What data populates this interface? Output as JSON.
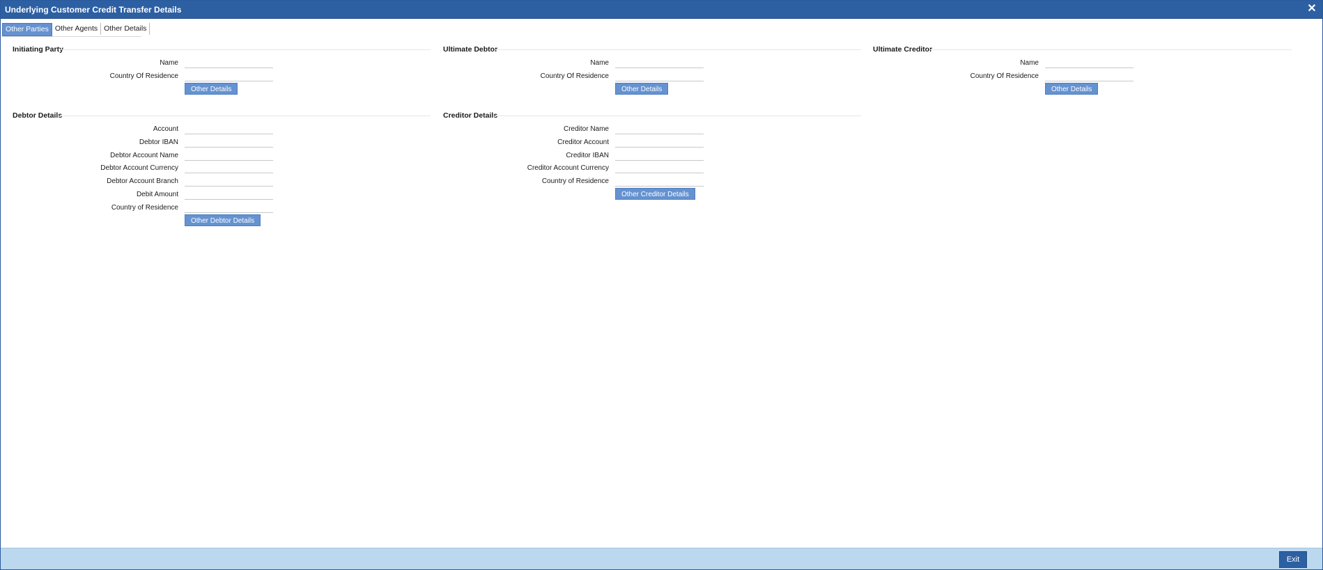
{
  "window": {
    "title": "Underlying Customer Credit Transfer Details",
    "close_symbol": "✕",
    "close_icon": "close-icon"
  },
  "tabs": [
    {
      "label": "Other Parties",
      "active": true
    },
    {
      "label": "Other Agents",
      "active": false
    },
    {
      "label": "Other Details",
      "active": false
    }
  ],
  "initiating_party": {
    "title": "Initiating Party",
    "name_label": "Name",
    "country_label": "Country Of Residence",
    "button_label": "Other Details"
  },
  "ultimate_debtor": {
    "title": "Ultimate Debtor",
    "name_label": "Name",
    "country_label": "Country Of Residence",
    "button_label": "Other Details"
  },
  "ultimate_creditor": {
    "title": "Ultimate Creditor",
    "name_label": "Name",
    "country_label": "Country Of Residence",
    "button_label": "Other Details"
  },
  "debtor_details": {
    "title": "Debtor Details",
    "fields": [
      "Account",
      "Debtor IBAN",
      "Debtor Account Name",
      "Debtor Account Currency",
      "Debtor Account Branch",
      "Debit Amount",
      "Country of Residence"
    ],
    "button_label": "Other Debtor Details"
  },
  "creditor_details": {
    "title": "Creditor Details",
    "fields": [
      "Creditor Name",
      "Creditor Account",
      "Creditor IBAN",
      "Creditor Account Currency",
      "Country of Residence"
    ],
    "button_label": "Other Creditor Details"
  },
  "footer": {
    "exit_label": "Exit"
  },
  "colors": {
    "titlebar": "#2d5fa3",
    "tab_active": "#6592d0",
    "button": "#6592d0",
    "footer": "#bcd8ef"
  }
}
